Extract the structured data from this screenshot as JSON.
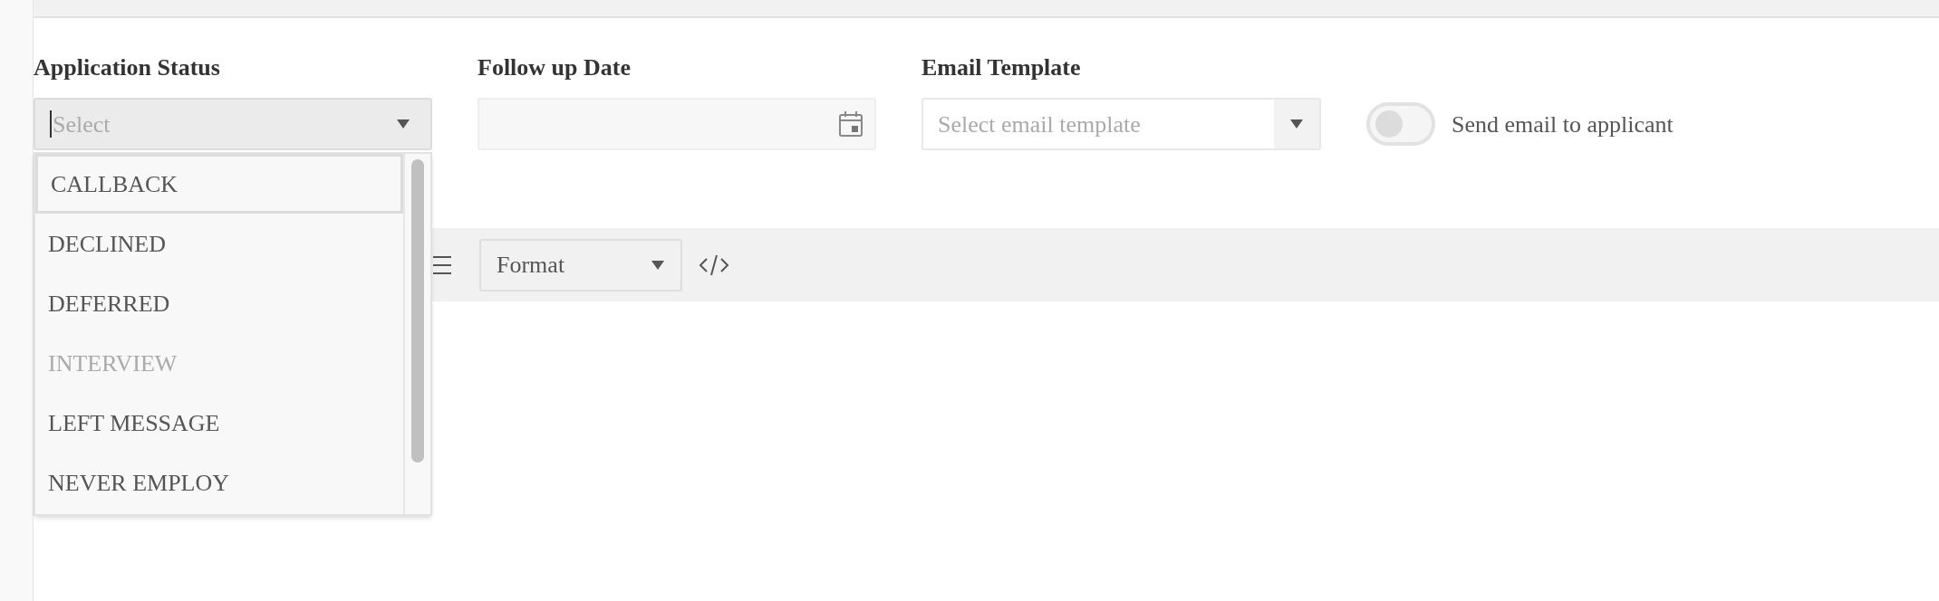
{
  "application_status": {
    "label": "Application Status",
    "placeholder": "Select",
    "expanded": true,
    "options": [
      {
        "label": "CALLBACK",
        "selected": true,
        "disabled": false
      },
      {
        "label": "DECLINED",
        "selected": false,
        "disabled": false
      },
      {
        "label": "DEFERRED",
        "selected": false,
        "disabled": false
      },
      {
        "label": "INTERVIEW",
        "selected": false,
        "disabled": true
      },
      {
        "label": "LEFT MESSAGE",
        "selected": false,
        "disabled": false
      },
      {
        "label": "NEVER EMPLOY",
        "selected": false,
        "disabled": false
      }
    ]
  },
  "follow_up_date": {
    "label": "Follow up Date"
  },
  "email_template": {
    "label": "Email Template",
    "placeholder": "Select email template"
  },
  "send_email": {
    "label": "Send email to applicant",
    "on": false
  },
  "editor_toolbar": {
    "format": "Format"
  }
}
